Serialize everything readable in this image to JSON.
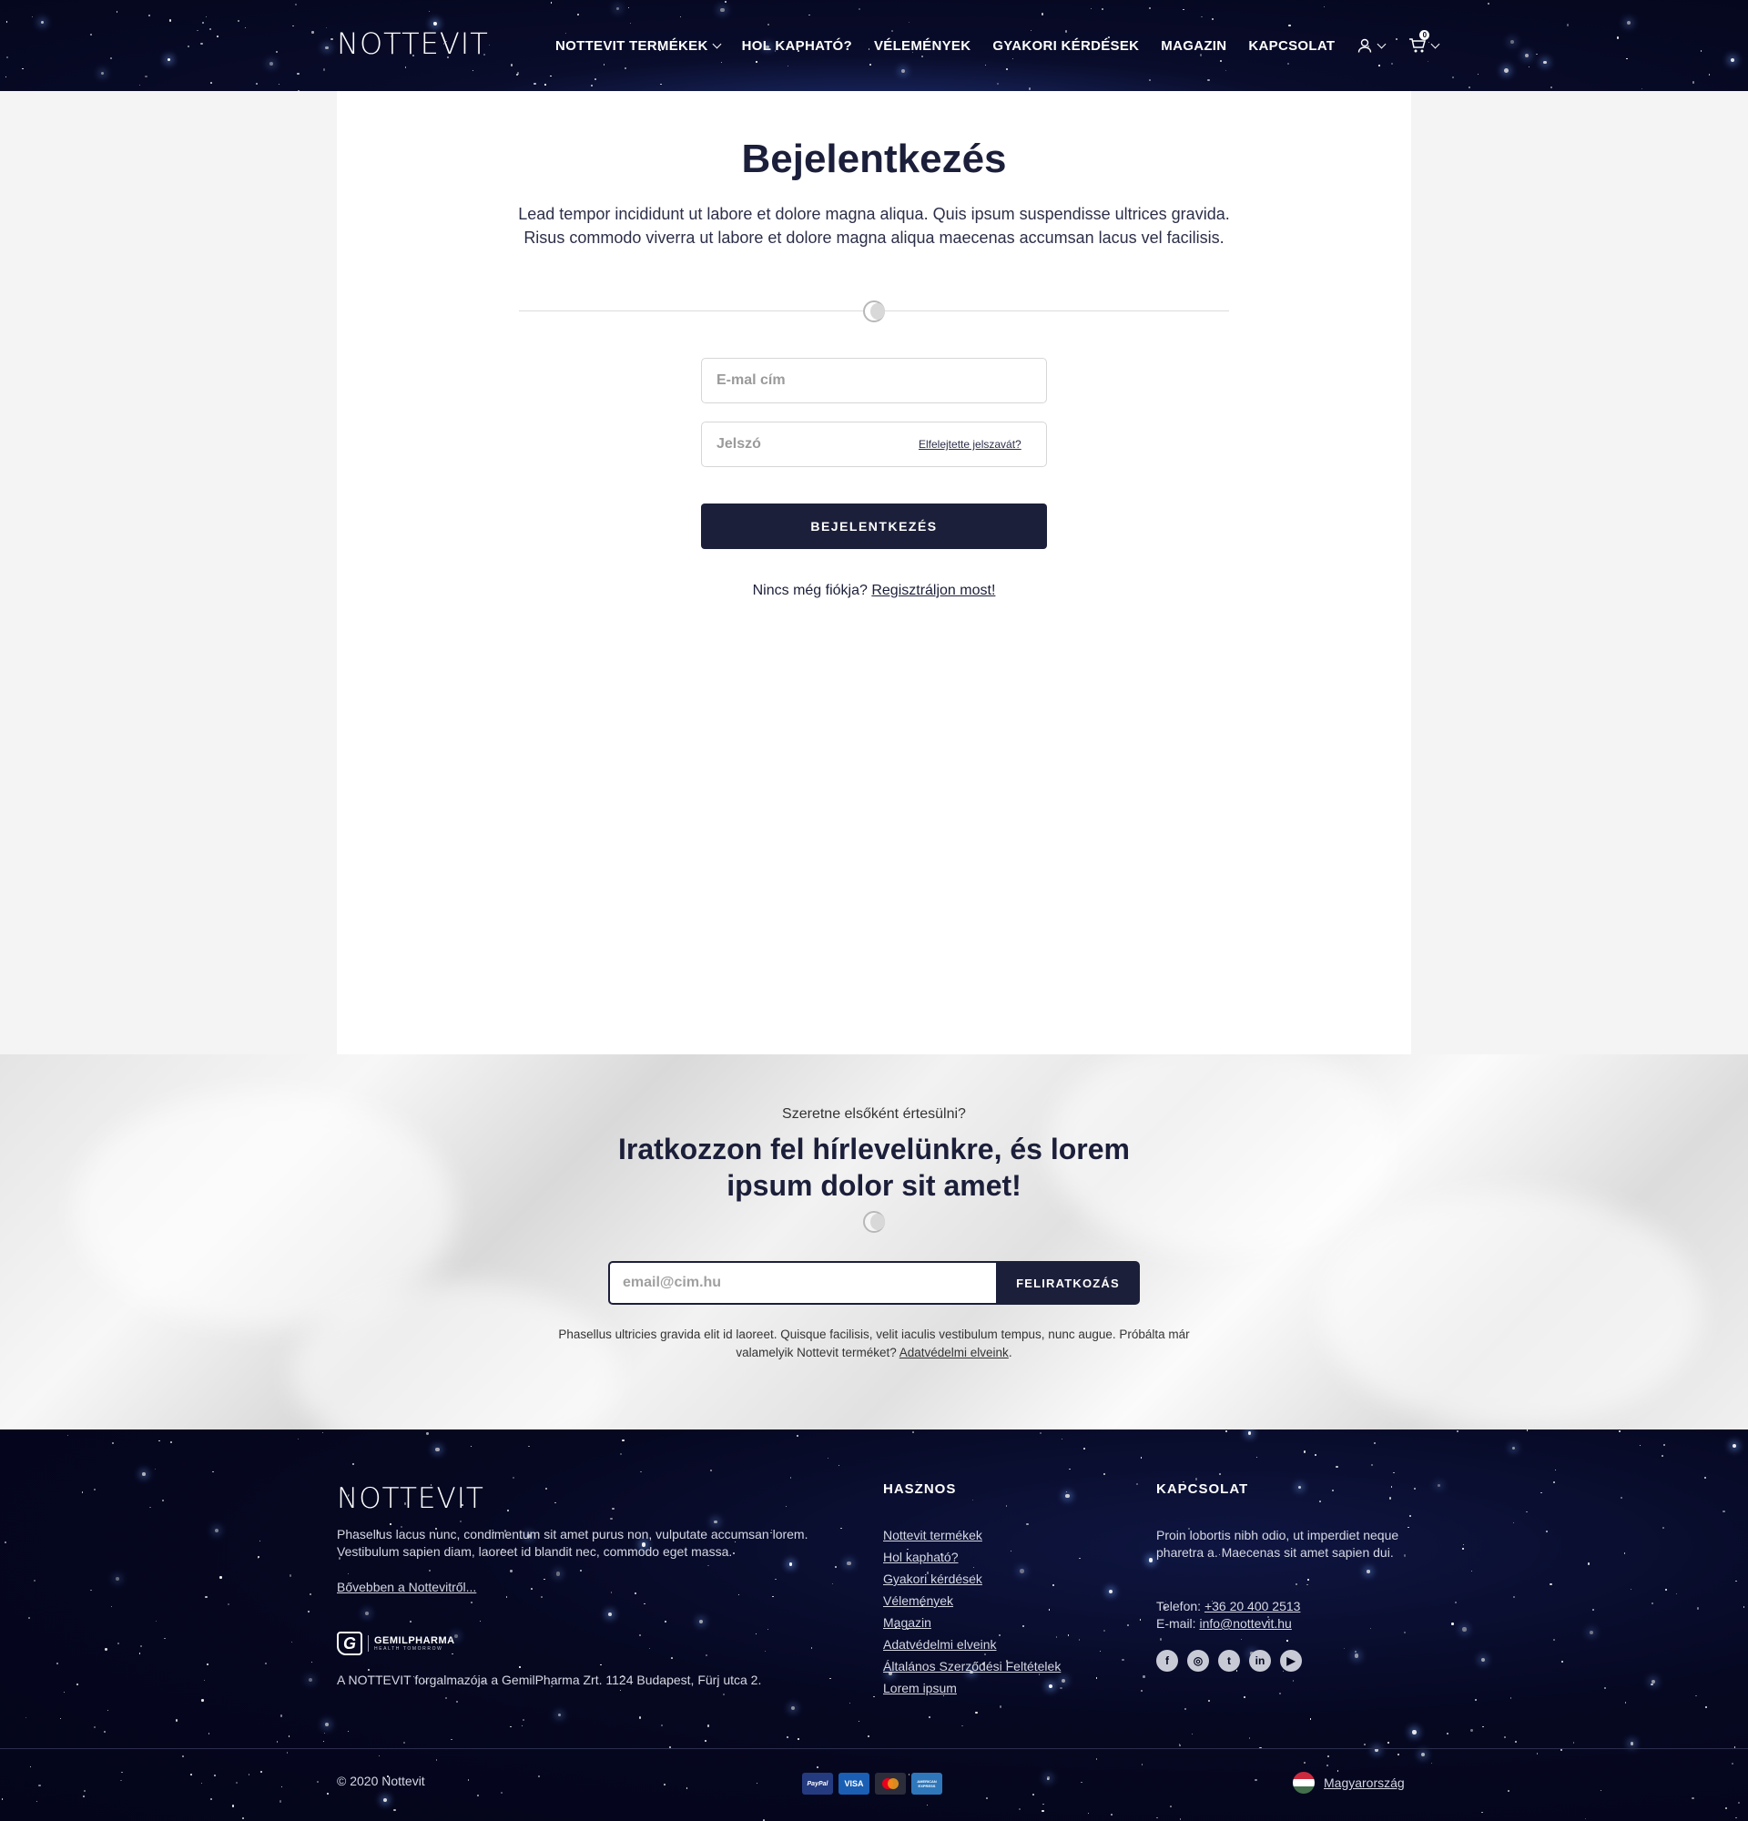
{
  "header": {
    "logo": "NOTTEVIT",
    "nav": [
      {
        "label": "NOTTEVIT TERMÉKEK"
      },
      {
        "label": "HOL KAPHATÓ?"
      },
      {
        "label": "VÉLEMÉNYEK"
      },
      {
        "label": "GYAKORI KÉRDÉSEK"
      },
      {
        "label": "MAGAZIN"
      },
      {
        "label": "KAPCSOLAT"
      }
    ],
    "cart_count": "0"
  },
  "login": {
    "title": "Bejelentkezés",
    "lead": "Lead tempor incididunt ut labore et dolore magna aliqua. Quis ipsum suspendisse ultrices gravida. Risus commodo viverra ut labore et dolore magna aliqua maecenas accumsan lacus vel facilisis.",
    "email_placeholder": "E-mal cím",
    "password_placeholder": "Jelszó",
    "forgot": "Elfelejtette jelszavát?",
    "submit": "BEJELENTKEZÉS",
    "no_account": "Nincs még fiókja?",
    "register": "Regisztráljon most!"
  },
  "newsletter": {
    "subtitle": "Szeretne elsőként értesülni?",
    "title": "Iratkozzon fel hírlevelünkre, és lorem ipsum dolor sit amet!",
    "placeholder": "email@cim.hu",
    "button": "FELIRATKOZÁS",
    "note": "Phasellus ultricies gravida elit id laoreet. Quisque facilisis, velit iaculis vestibulum tempus, nunc augue. Próbálta már valamelyik Nottevit terméket?",
    "privacy_link": "Adatvédelmi elveink"
  },
  "footer": {
    "logo": "NOTTEVIT",
    "description": "Phasellus lacus nunc, condimentum sit amet purus non, vulputate accumsan lorem. Vestibulum sapien diam, laoreet id blandit nec, commodo eget massa.",
    "more_link": "Bővebben a Nottevitről...",
    "gemil_name": "GEMILPHARMA",
    "gemil_tagline": "HEALTH TOMORROW",
    "distributor": "A NOTTEVIT forgalmazója a GemilPharma Zrt. 1124 Budapest, Fürj utca 2.",
    "useful_title": "HASZNOS",
    "useful_links": [
      "Nottevit termékek",
      "Hol kapható?",
      "Gyakori kérdések",
      "Vélemények",
      "Magazin",
      "Adatvédelmi elveink",
      "Általános Szerződési Feltételek",
      "Lorem ipsum"
    ],
    "contact_title": "KAPCSOLAT",
    "contact_text": "Proin lobortis nibh odio, ut imperdiet neque pharetra a. Maecenas sit amet sapien dui.",
    "phone_label": "Telefon:",
    "phone": "+36 20 400 2513",
    "email_label": "E-mail:",
    "email": "info@nottevit.hu",
    "socials": [
      "facebook-icon",
      "instagram-icon",
      "twitter-icon",
      "linkedin-icon",
      "youtube-icon"
    ],
    "copyright": "© 2020 Nottevit",
    "payments": [
      {
        "name": "PayPal",
        "color": "#253b80"
      },
      {
        "name": "VISA",
        "color": "#1a5fb4"
      },
      {
        "name": "",
        "color": "#2b2d3a"
      },
      {
        "name": "AMERICAN EXPRESS",
        "color": "#2e77bb"
      }
    ],
    "country": "Magyarország"
  }
}
